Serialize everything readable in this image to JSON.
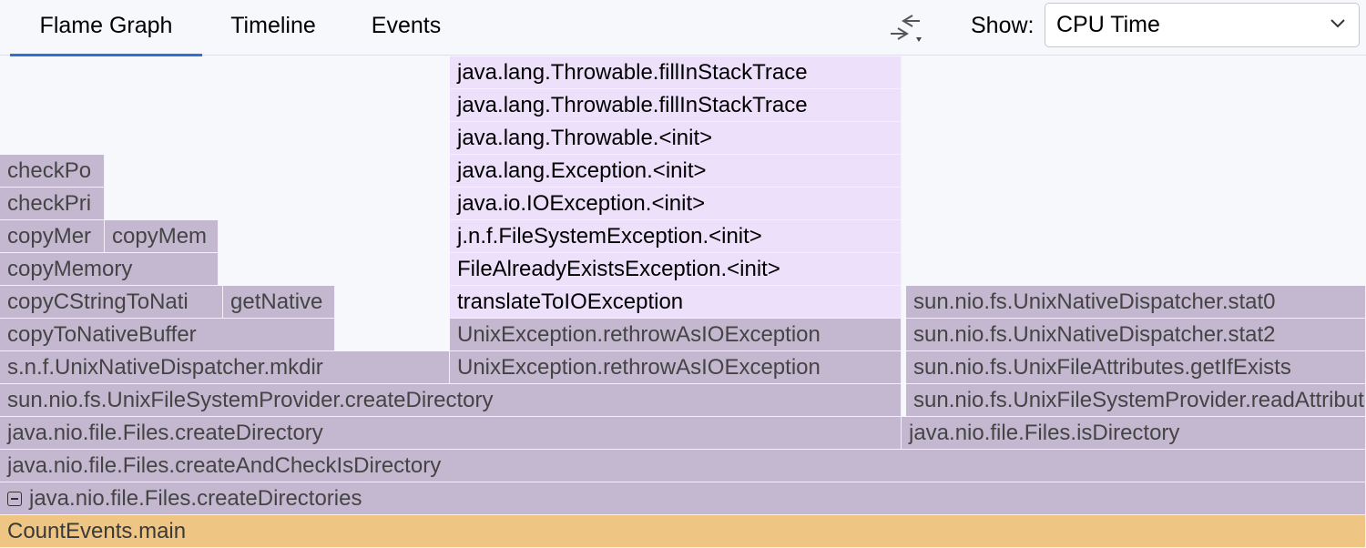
{
  "tabs": [
    {
      "label": "Flame Graph",
      "active": true
    },
    {
      "label": "Timeline",
      "active": false
    },
    {
      "label": "Events",
      "active": false
    }
  ],
  "toolbar": {
    "collapse_icon": "collapse-arrows-icon",
    "show_label": "Show:",
    "show_value": "CPU Time",
    "dropdown_icon": "chevron-down-icon"
  },
  "colors": {
    "frame": "#c4b8d1",
    "highlighted_frame": "#ede0fb",
    "root_frame": "#efc583",
    "active_tab_underline": "#2f6fd6"
  },
  "frames": {
    "fillInStackTrace_1": "java.lang.Throwable.fillInStackTrace",
    "fillInStackTrace_2": "java.lang.Throwable.fillInStackTrace",
    "throwable_init": "java.lang.Throwable.<init>",
    "exception_init": "java.lang.Exception.<init>",
    "ioexception_init": "java.io.IOException.<init>",
    "fsexception_init": "j.n.f.FileSystemException.<init>",
    "faeexception_init": "FileAlreadyExistsException.<init>",
    "translateToIOException": "translateToIOException",
    "rethrowAsIOException_1": "UnixException.rethrowAsIOException",
    "rethrowAsIOException_2": "UnixException.rethrowAsIOException",
    "checkPo": "checkPo",
    "checkPri": "checkPri",
    "copyMer": "copyMer",
    "copyMem": "copyMem",
    "copyMemory": "copyMemory",
    "copyCStringToNati": "copyCStringToNati",
    "getNative": "getNative",
    "copyToNativeBuffer": "copyToNativeBuffer",
    "mkdir": "s.n.f.UnixNativeDispatcher.mkdir",
    "createDirectory_provider": "sun.nio.fs.UnixFileSystemProvider.createDirectory",
    "createDirectory_files": "java.nio.file.Files.createDirectory",
    "stat0": "sun.nio.fs.UnixNativeDispatcher.stat0",
    "stat2": "sun.nio.fs.UnixNativeDispatcher.stat2",
    "getIfExists": "sun.nio.fs.UnixFileAttributes.getIfExists",
    "readAttributes": "sun.nio.fs.UnixFileSystemProvider.readAttributes",
    "isDirectory": "java.nio.file.Files.isDirectory",
    "createAndCheckIsDirectory": "java.nio.file.Files.createAndCheckIsDirectory",
    "createDirectories": "java.nio.file.Files.createDirectories",
    "main": "CountEvents.main"
  }
}
